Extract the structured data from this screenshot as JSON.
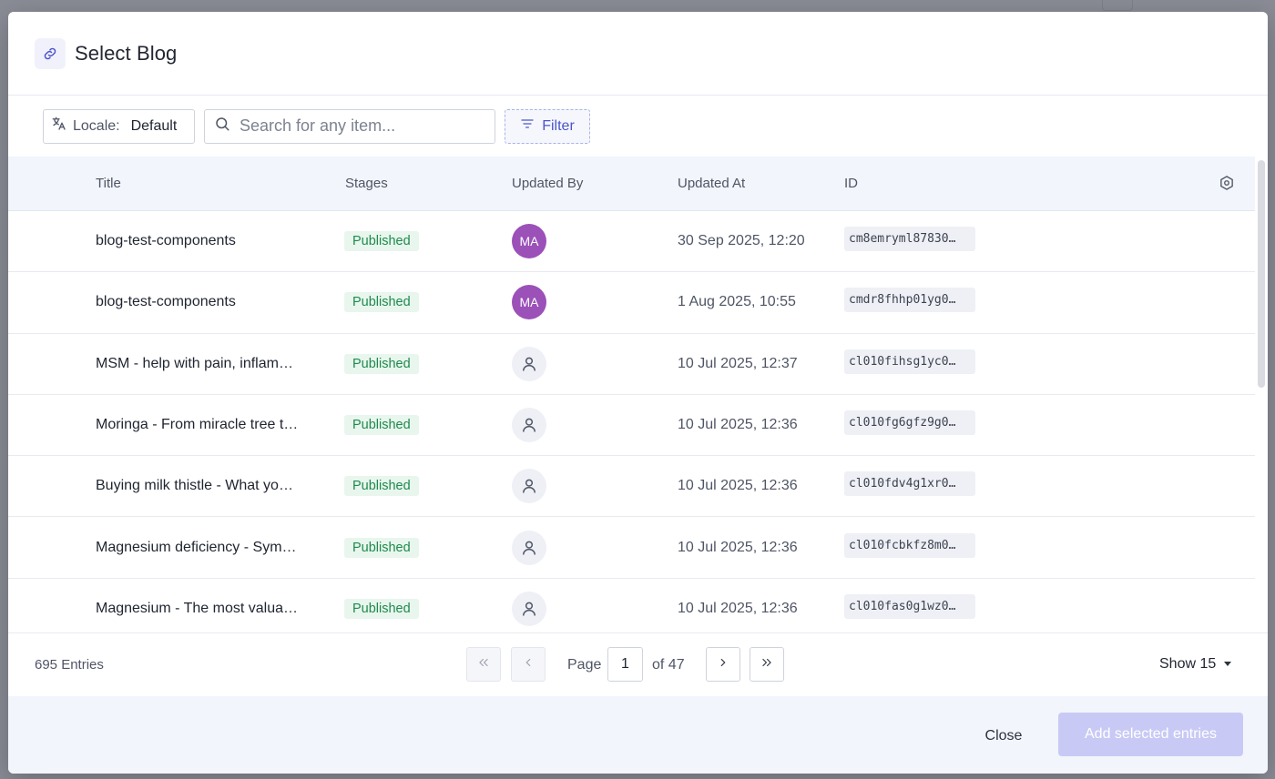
{
  "modal": {
    "title": "Select Blog"
  },
  "toolbar": {
    "locale_label": "Locale:",
    "locale_value": "Default",
    "search_placeholder": "Search for any item...",
    "filter_label": "Filter"
  },
  "table": {
    "columns": {
      "title": "Title",
      "stages": "Stages",
      "updated_by": "Updated By",
      "updated_at": "Updated At",
      "id": "ID"
    },
    "rows": [
      {
        "title": "blog-test-components",
        "stage": "Published",
        "user": "MA",
        "user_type": "initials",
        "updated_at": "30 Sep 2025, 12:20",
        "id": "cm8emryml87830…"
      },
      {
        "title": "blog-test-components",
        "stage": "Published",
        "user": "MA",
        "user_type": "initials",
        "updated_at": "1 Aug 2025, 10:55",
        "id": "cmdr8fhhp01yg0…"
      },
      {
        "title": "MSM - help with pain, inflam…",
        "stage": "Published",
        "user": "",
        "user_type": "generic",
        "updated_at": "10 Jul 2025, 12:37",
        "id": "cl010fihsg1yc0…"
      },
      {
        "title": "Moringa - From miracle tree t…",
        "stage": "Published",
        "user": "",
        "user_type": "generic",
        "updated_at": "10 Jul 2025, 12:36",
        "id": "cl010fg6gfz9g0…"
      },
      {
        "title": "Buying milk thistle - What yo…",
        "stage": "Published",
        "user": "",
        "user_type": "generic",
        "updated_at": "10 Jul 2025, 12:36",
        "id": "cl010fdv4g1xr0…"
      },
      {
        "title": "Magnesium deficiency - Sym…",
        "stage": "Published",
        "user": "",
        "user_type": "generic",
        "updated_at": "10 Jul 2025, 12:36",
        "id": "cl010fcbkfz8m0…"
      },
      {
        "title": "Magnesium - The most valua…",
        "stage": "Published",
        "user": "",
        "user_type": "generic",
        "updated_at": "10 Jul 2025, 12:36",
        "id": "cl010fas0g1wz0…"
      }
    ]
  },
  "pagination": {
    "entries": "695 Entries",
    "page_label": "Page",
    "current_page": "1",
    "of_label": "of 47",
    "show_label": "Show 15"
  },
  "footer": {
    "close_label": "Close",
    "add_label": "Add selected entries"
  },
  "colors": {
    "accent": "#4a55c9",
    "published_badge_bg": "#e8f6ee",
    "published_badge_text": "#1f8a4c",
    "avatar_initials": "#9b51b8",
    "add_button_disabled": "#c8caf5"
  }
}
